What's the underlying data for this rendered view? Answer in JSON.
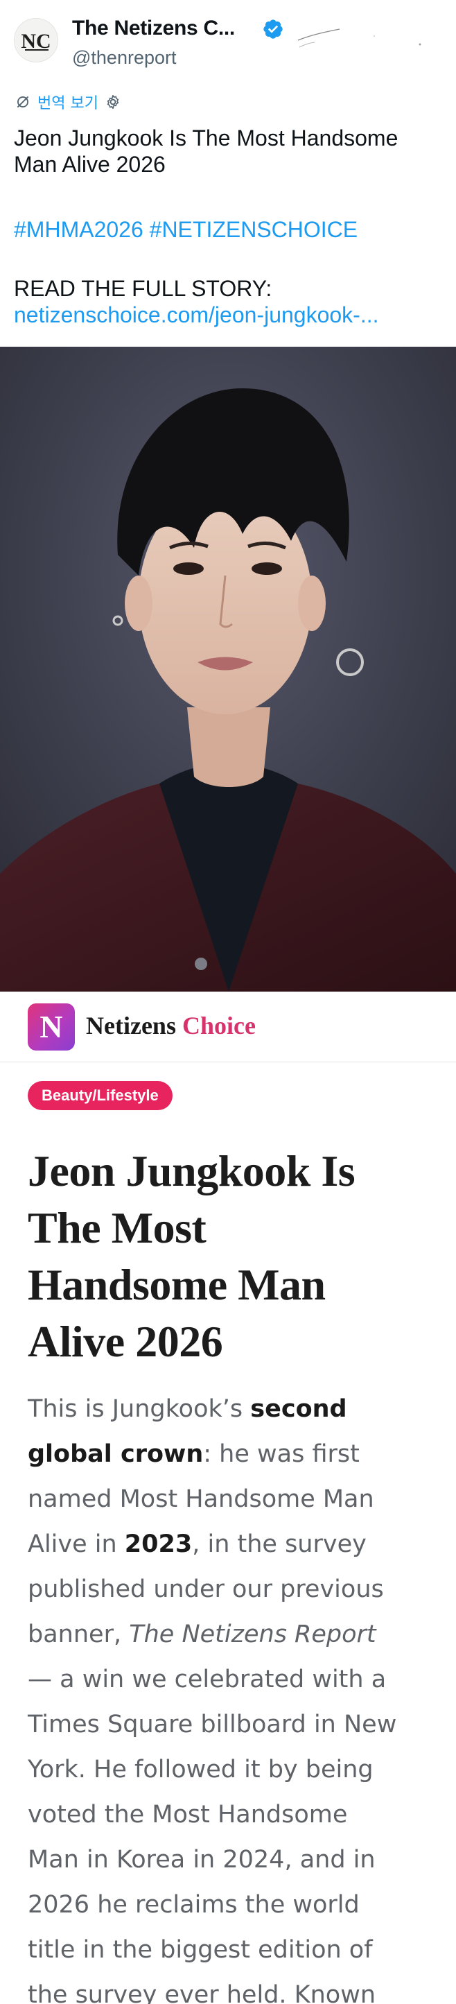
{
  "tweet": {
    "author_name": "The Netizens C...",
    "handle": "@thenreport",
    "avatar_letters": "NC",
    "translate_label": "번역 보기",
    "text": "Jeon Jungkook Is The Most Handsome Man Alive 2026",
    "text_line1": "Jeon Jungkook Is The Most Handsome",
    "text_line2": "Man Alive 2026",
    "hashtags": "#MHMA2026 #NETIZENSCHOICE",
    "read_more": "READ THE FULL STORY:",
    "link_text": "netizenschoice.com/jeon-jungkook-...",
    "link_color": "#1d9bf0",
    "icons": [
      "verified-badge-icon",
      "translate-icon",
      "settings-gear-icon"
    ]
  },
  "site": {
    "logo_letter": "N",
    "name_part1": "Netizens",
    "name_part2": "Choice",
    "brand_color": "#d6336c"
  },
  "article": {
    "category": "Beauty/Lifestyle",
    "category_color": "#e8245e",
    "title_lines": [
      "Jeon Jungkook Is",
      "The Most",
      "Handsome Man",
      "Alive 2026"
    ],
    "body": {
      "l1_a": "This is Jungkook’s ",
      "l1_b": "second",
      "l2_a": "global crown",
      "l2_b": ": he was first",
      "l3": "named Most Handsome Man",
      "l4_a": "Alive in ",
      "l4_b": "2023",
      "l4_c": ", in the survey",
      "l5": "published under our previous",
      "l6_a": "banner, ",
      "l6_b": "The Netizens Report",
      "l7": "— a win we celebrated with a",
      "l8": "Times Square billboard in New",
      "l9": "York. He followed it by being",
      "l10": "voted the Most Handsome",
      "l11": "Man in Korea in 2024, and in",
      "l12": "2026 he reclaims the world",
      "l13": "title in the biggest edition of",
      "l14": "the survey ever held. Known"
    }
  }
}
